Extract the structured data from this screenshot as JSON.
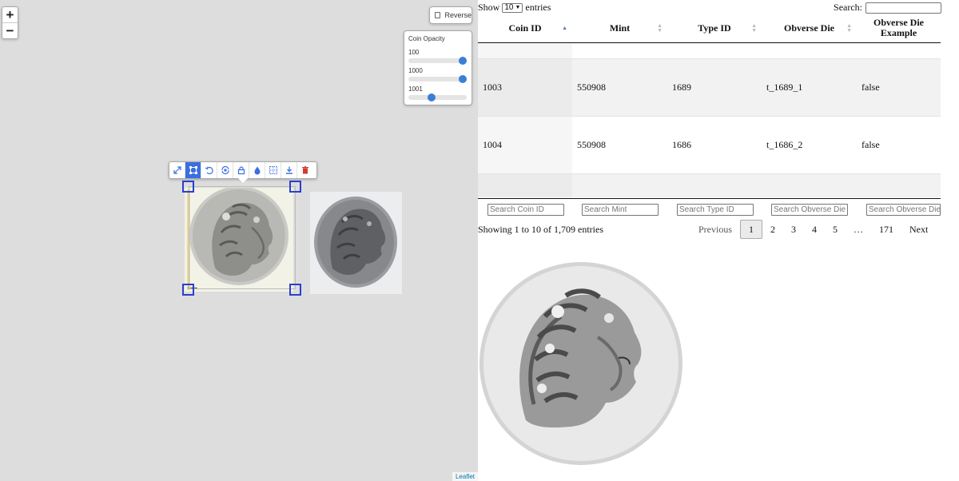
{
  "map": {
    "zoom_in": "+",
    "zoom_out": "−",
    "reverse_label": "Reverse",
    "opacity_title": "Coin Opacity",
    "sliders": [
      {
        "label": "100",
        "value": 1.0
      },
      {
        "label": "1000",
        "value": 1.0
      },
      {
        "label": "1001",
        "value": 0.38
      }
    ],
    "toolbar_icons": [
      "expand-icon",
      "distort-icon",
      "rotate-icon",
      "scale-icon",
      "lock-icon",
      "opacity-icon",
      "border-icon",
      "export-icon",
      "delete-icon"
    ],
    "active_tool": "distort-icon",
    "attribution": "Leaflet"
  },
  "table": {
    "show_label": "Show",
    "page_size": "10",
    "entries_label": "entries",
    "search_label": "Search:",
    "columns": [
      {
        "label": "Coin ID",
        "sort": "asc"
      },
      {
        "label": "Mint",
        "sort": "none"
      },
      {
        "label": "Type ID",
        "sort": "none"
      },
      {
        "label": "Obverse Die",
        "sort": "none"
      },
      {
        "label": "Obverse Die Example",
        "sort": "none"
      }
    ],
    "rows": [
      [
        "1003",
        "550908",
        "1689",
        "t_1689_1",
        "false"
      ],
      [
        "1004",
        "550908",
        "1686",
        "t_1686_2",
        "false"
      ]
    ],
    "filter_placeholders": [
      "Search Coin ID",
      "Search Mint",
      "Search Type ID",
      "Search Obverse Die",
      "Search Obverse Die Example"
    ],
    "info": "Showing 1 to 10 of 1,709 entries",
    "pagination": {
      "previous": "Previous",
      "pages": [
        "1",
        "2",
        "3",
        "4",
        "5",
        "…",
        "171"
      ],
      "current": "1",
      "next": "Next"
    }
  },
  "colors": {
    "accent": "#3b6fe0",
    "handle": "#2a3fcf",
    "slider_thumb": "#3a7fd5",
    "map_bg": "#dddddd"
  }
}
